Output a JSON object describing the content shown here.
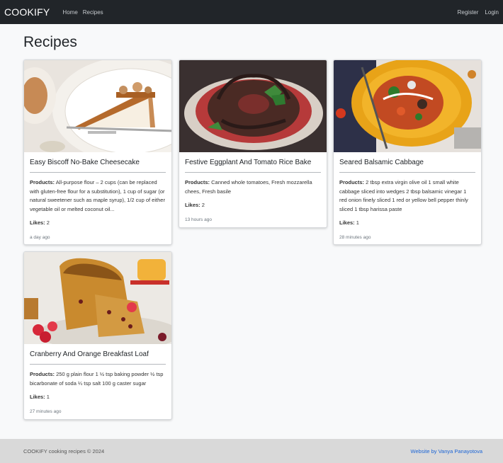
{
  "nav": {
    "brand": "COOKIFY",
    "links": [
      "Home",
      "Recipes"
    ],
    "right_links": [
      "Register",
      "Login"
    ]
  },
  "page": {
    "title": "Recipes"
  },
  "labels": {
    "products": "Products:",
    "likes": "Likes:"
  },
  "recipes": [
    {
      "title": "Easy Biscoff No-Bake Cheesecake",
      "products": "All-purpose flour – 2 cups (can be replaced with gluten-free flour for a substitution), 1 cup of sugar (or natural sweetener such as maple syrup), 1/2 cup of either vegetable oil or melted coconut oil...",
      "likes": "2",
      "time": "a day ago",
      "image": "cheesecake-slice"
    },
    {
      "title": "Festive Eggplant And Tomato Rice Bake",
      "products": "Canned whole tomatoes, Fresh mozzarella chees, Fresh basile",
      "likes": "2",
      "time": "13 hours ago",
      "image": "eggplant-ring"
    },
    {
      "title": "Seared Balsamic Cabbage",
      "products": "2 tbsp extra virgin olive oil 1 small white cabbage sliced into wedges 2 tbsp balsamic vinegar 1 red onion finely sliced 1 red or yellow bell pepper thinly sliced 1 tbsp harissa paste",
      "likes": "1",
      "time": "28 minutes ago",
      "image": "cabbage-plate"
    },
    {
      "title": "Cranberry And Orange Breakfast Loaf",
      "products": "250 g plain flour 1 ½ tsp baking powder ½ tsp bicarbonate of soda ¼ tsp salt 100 g caster sugar",
      "likes": "1",
      "time": "27 minutes ago",
      "image": "cranberry-loaf"
    }
  ],
  "footer": {
    "copyright": "COOKIFY cooking recipes © 2024",
    "credit": "Website by Vanya Panayotova"
  }
}
